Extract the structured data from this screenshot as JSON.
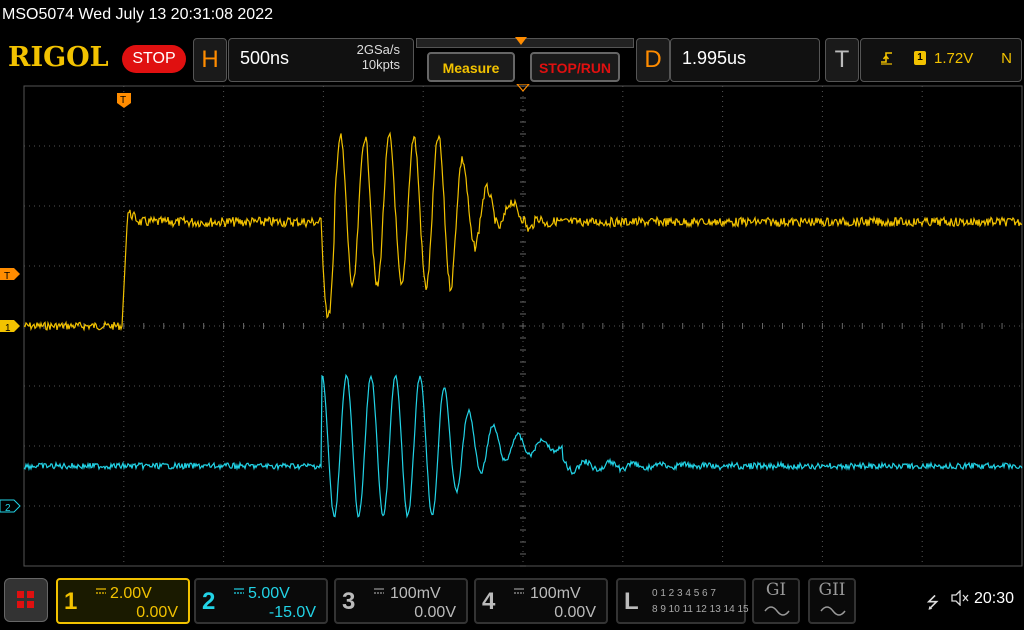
{
  "title_bar": {
    "text": "MSO5074  Wed July 13 20:31:08 2022"
  },
  "brand": {
    "logo": "RIGOL",
    "status": "STOP"
  },
  "horizontal": {
    "letter": "H",
    "timebase": "500ns",
    "sample_rate": "2GSa/s",
    "memory_depth": "10kpts"
  },
  "buttons": {
    "measure": "Measure",
    "stop_run": "STOP/RUN"
  },
  "delay": {
    "letter": "D",
    "value": "1.995us"
  },
  "trigger": {
    "letter": "T",
    "source": "1",
    "level": "1.72V",
    "mode": "N",
    "edge_icon": "rising-edge-icon"
  },
  "markers": {
    "trigger_level": "T",
    "ch1": "1",
    "ch2": "2",
    "trigger_pos": "T"
  },
  "channels": [
    {
      "num": "1",
      "scale": "2.00V",
      "offset": "0.00V",
      "color": "#f2c200"
    },
    {
      "num": "2",
      "scale": "5.00V",
      "offset": "-15.0V",
      "color": "#22d3e6"
    },
    {
      "num": "3",
      "scale": "100mV",
      "offset": "0.00V",
      "color": "#bbbbbb"
    },
    {
      "num": "4",
      "scale": "100mV",
      "offset": "0.00V",
      "color": "#bbbbbb"
    }
  ],
  "logic": {
    "num": "L",
    "row1": "0 1 2 3  4 5 6 7",
    "row2": "8 9 10 11 12 13 14 15"
  },
  "generators": {
    "g1": "GI",
    "g2": "GII"
  },
  "status": {
    "time": "20:30",
    "usb_icon": "usb-icon",
    "sound_icon": "speaker-muted-icon"
  },
  "colors": {
    "ch1": "#f2c200",
    "ch2": "#22d3e6",
    "accent": "#ff8c00",
    "stop": "#e01010"
  }
}
